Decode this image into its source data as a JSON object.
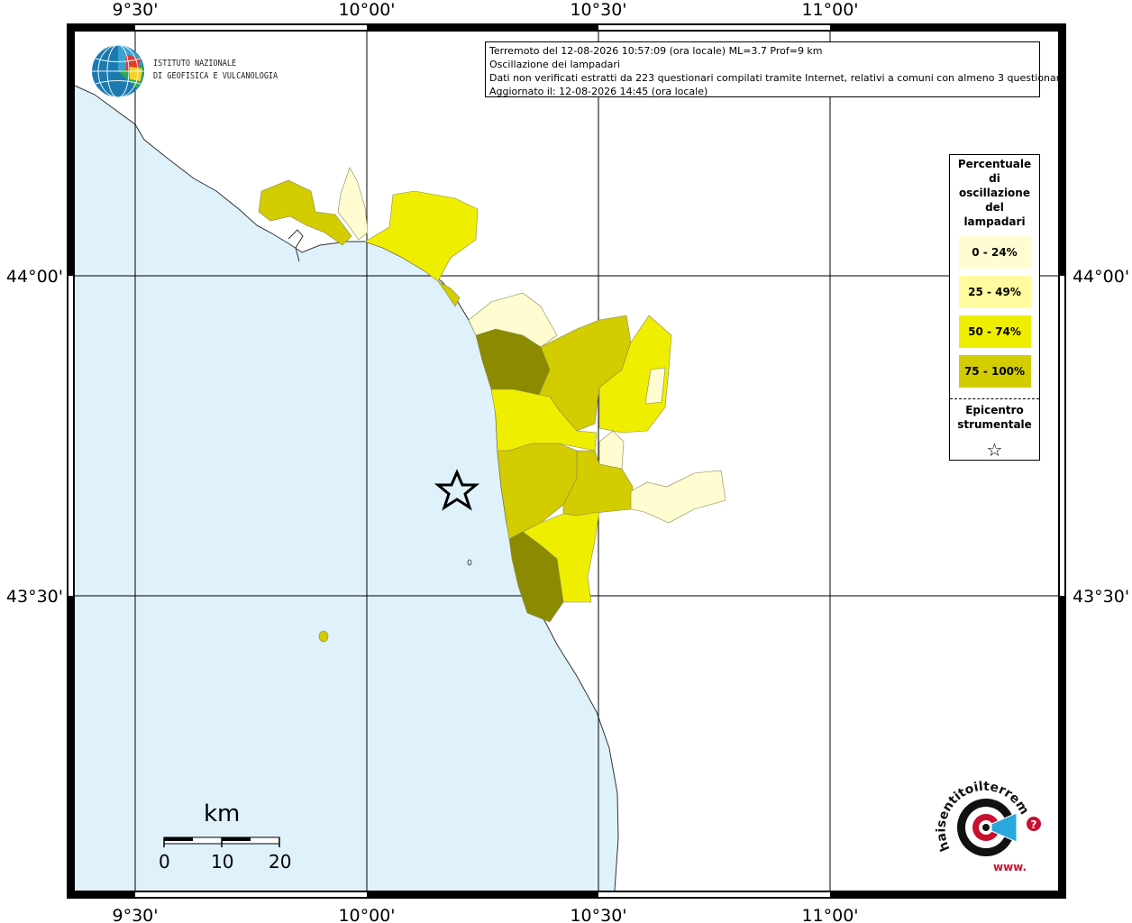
{
  "map": {
    "info_lines": [
      "Terremoto del 12-08-2026 10:57:09 (ora locale) ML=3.7 Prof=9 km",
      "Oscillazione dei lampadari",
      "Dati non verificati estratti da 223 questionari compilati tramite Internet, relativi a comuni con almeno 3 questionari.",
      "Aggiornato il: 12-08-2026 14:45 (ora locale)"
    ],
    "lon_ticks": [
      "9°30'",
      "10°00'",
      "10°30'",
      "11°00'"
    ],
    "lat_ticks": [
      "44°00'",
      "43°30'"
    ],
    "colors": {
      "sea": "#dff1fb",
      "land": "#ffffff",
      "class_0_24": "#fffcd2",
      "class_25_49": "#fffca0",
      "class_50_74": "#f0ee00",
      "class_75_100": "#d2cc00",
      "class_dark": "#8c8a00"
    }
  },
  "legend": {
    "title_lines": [
      "Percentuale",
      "di",
      "oscillazione",
      "del",
      "lampadari"
    ],
    "classes": [
      {
        "label": "0 - 24%",
        "color": "#fffcd2"
      },
      {
        "label": "25 - 49%",
        "color": "#fffca0"
      },
      {
        "label": "50 - 74%",
        "color": "#f0ee00"
      },
      {
        "label": "75 - 100%",
        "color": "#d2cc00"
      }
    ],
    "epicenter_title_lines": [
      "Epicentro",
      "strumentale"
    ],
    "epicenter_icon": "star-outline-icon"
  },
  "logos": {
    "ingv_lines": [
      "ISTITUTO NAZIONALE",
      "DI GEOFISICA E VULCANOLOGIA"
    ],
    "hst_text": "haisentitoilterremoto.it",
    "hst_www": "www."
  },
  "scale_bar": {
    "unit": "km",
    "labels": [
      "0",
      "10",
      "20"
    ]
  }
}
